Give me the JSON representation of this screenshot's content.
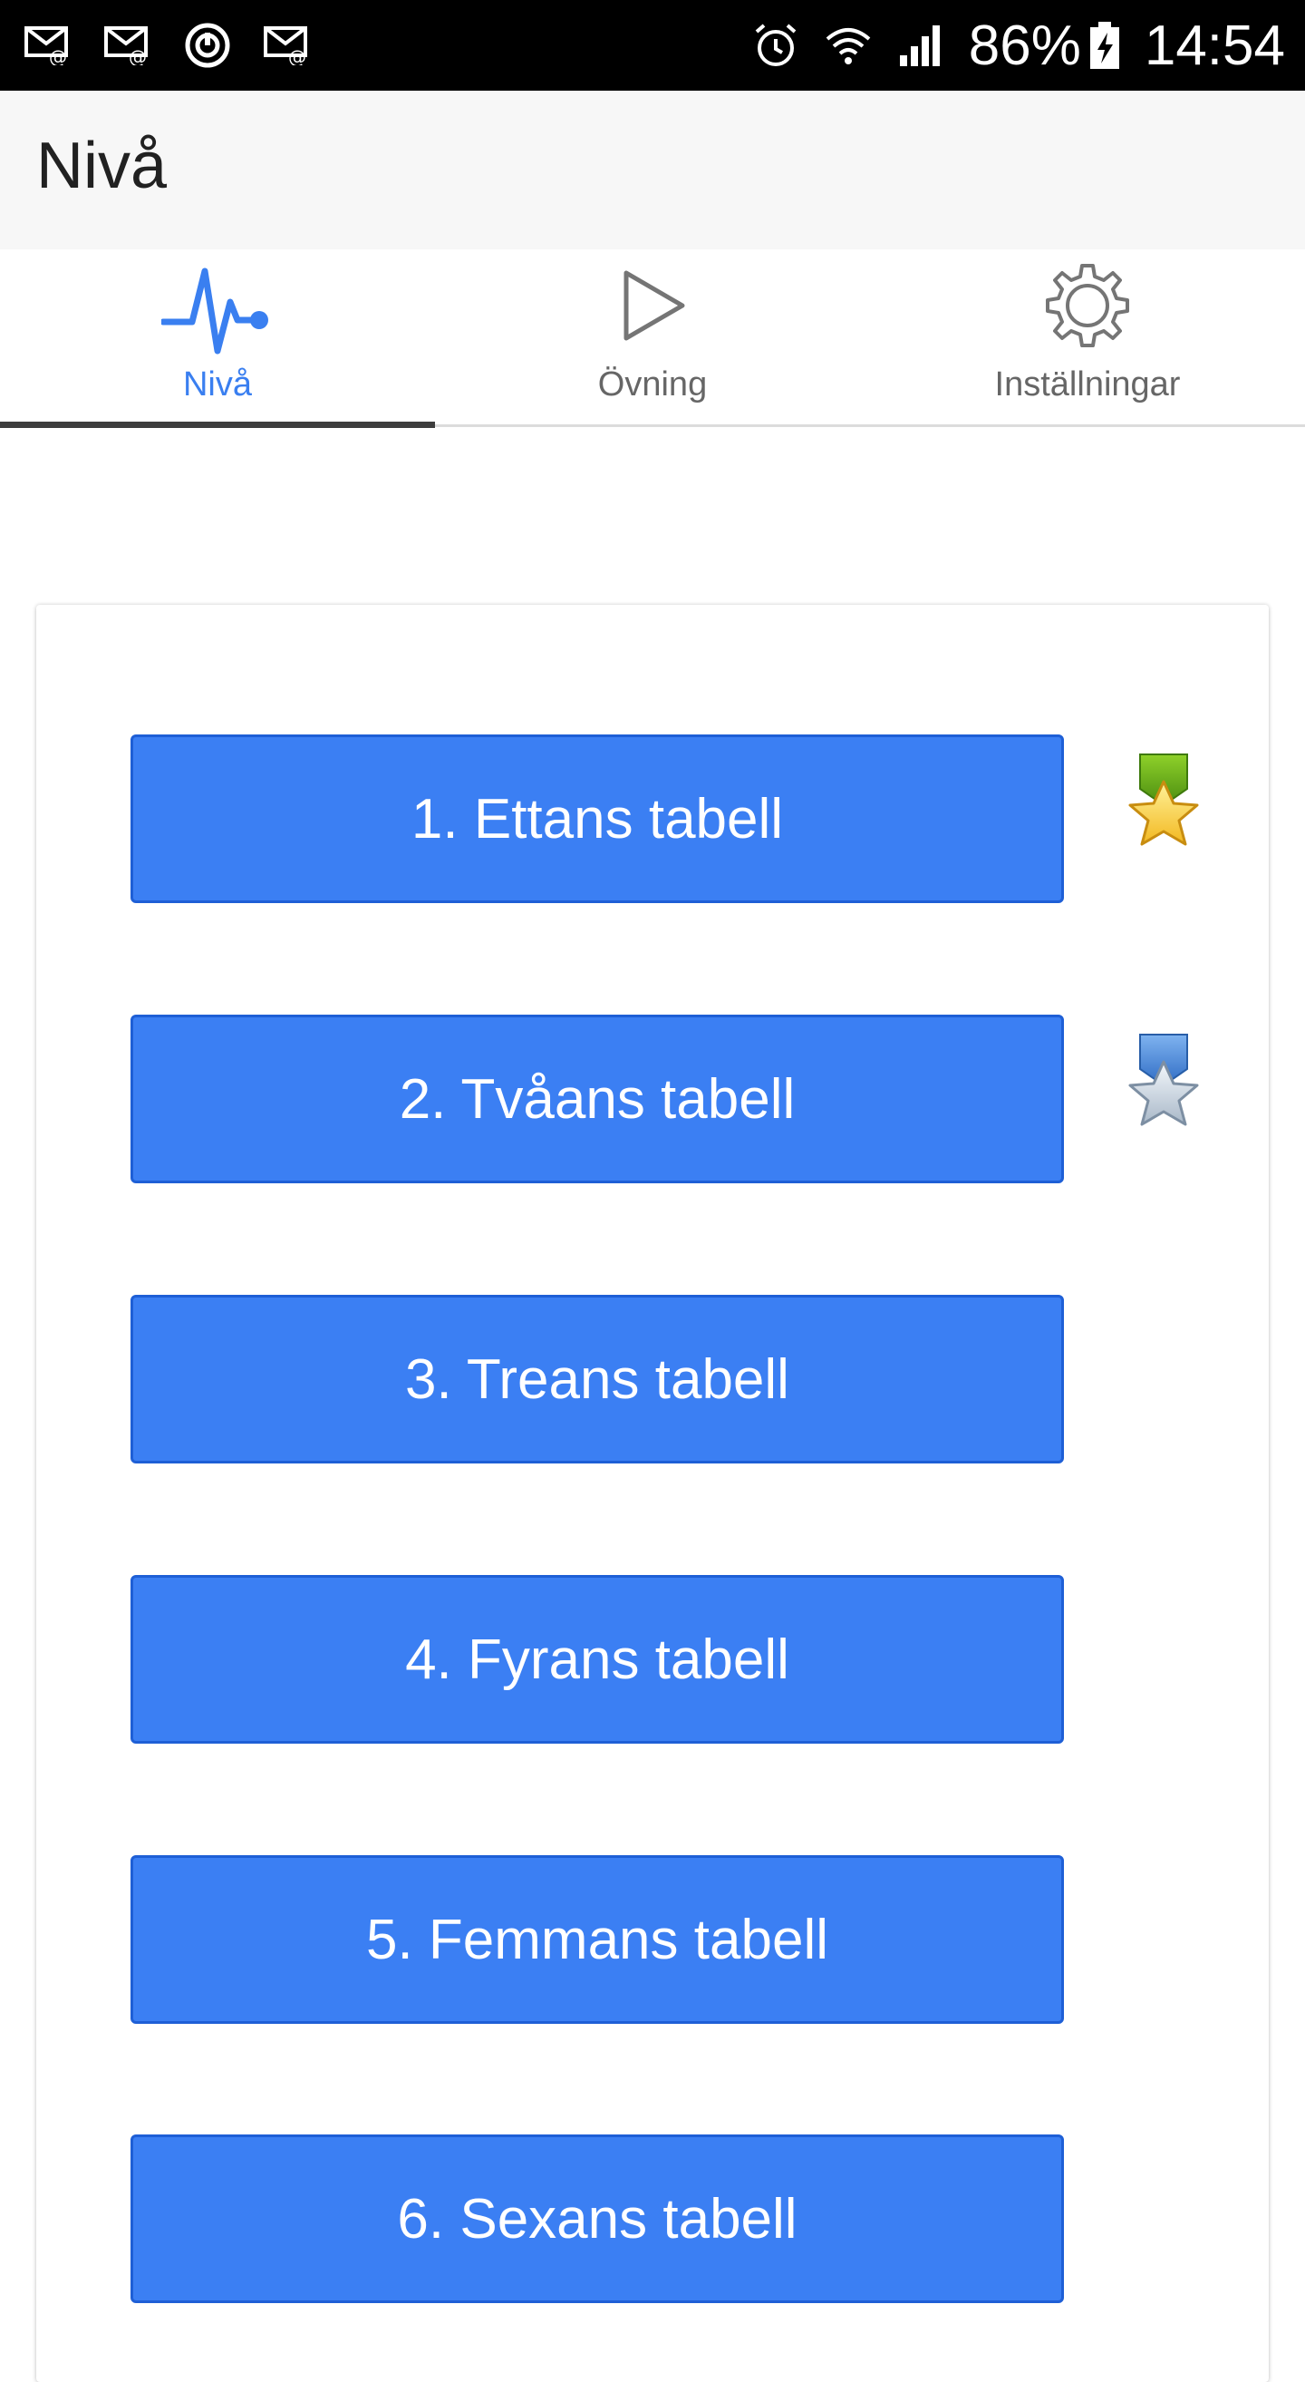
{
  "status_bar": {
    "battery": "86%",
    "time": "14:54"
  },
  "app_bar": {
    "title": "Nivå"
  },
  "tabs": [
    {
      "label": "Nivå",
      "icon": "pulse-icon",
      "active": true
    },
    {
      "label": "Övning",
      "icon": "play-icon",
      "active": false
    },
    {
      "label": "Inställningar",
      "icon": "gear-icon",
      "active": false
    }
  ],
  "levels": [
    {
      "label": "1. Ettans tabell",
      "medal": "gold-star-medal-icon"
    },
    {
      "label": "2. Tvåans tabell",
      "medal": "silver-star-medal-icon"
    },
    {
      "label": "3. Treans tabell",
      "medal": ""
    },
    {
      "label": "4. Fyrans tabell",
      "medal": ""
    },
    {
      "label": "5. Femmans tabell",
      "medal": ""
    },
    {
      "label": "6. Sexans tabell",
      "medal": ""
    }
  ],
  "colors": {
    "accent": "#3b7ff3",
    "active_tab": "#3a7ff0"
  }
}
